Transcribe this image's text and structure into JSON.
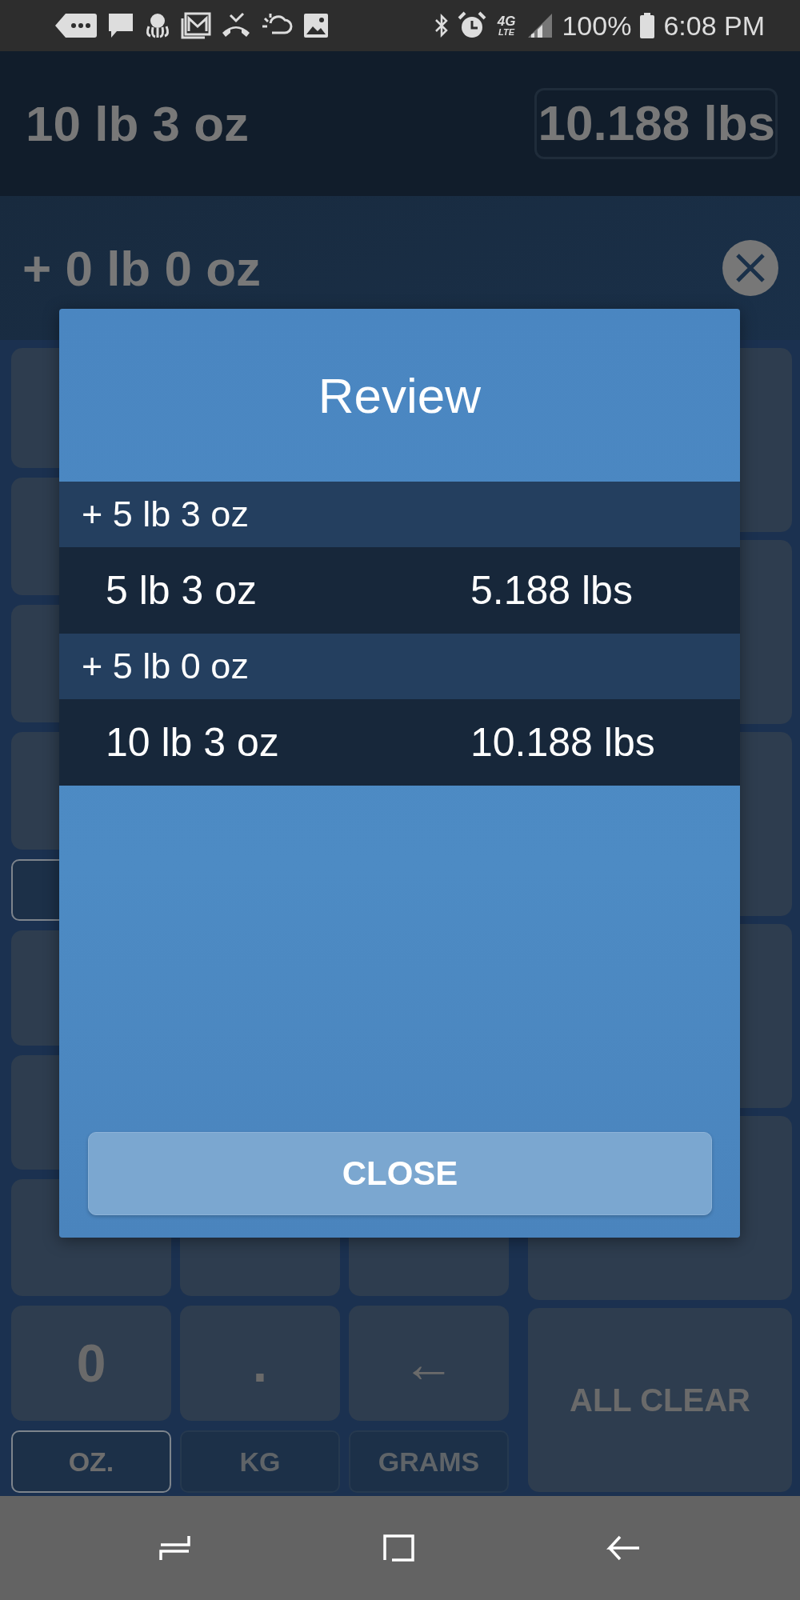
{
  "status_bar": {
    "network_top": "4G",
    "network_bottom": "LTE",
    "battery": "100%",
    "time": "6:08 PM"
  },
  "display": {
    "total": "10 lb 3 oz",
    "total_decimal": "10.188 lbs",
    "entry": "+ 0 lb 0 oz"
  },
  "keypad": {
    "upper_unit_toggle": {
      "selected": true
    },
    "keys": [
      {
        "label": "0"
      },
      {
        "label": "."
      },
      {
        "label": "←"
      }
    ],
    "units": [
      {
        "label": "OZ.",
        "selected": true
      },
      {
        "label": "KG",
        "selected": false
      },
      {
        "label": "GRAMS",
        "selected": false
      }
    ],
    "all_clear": "ALL CLEAR"
  },
  "dialog": {
    "title": "Review",
    "entries": [
      {
        "operation": "+ 5 lb 3 oz",
        "result": "5 lb 3 oz",
        "result_decimal": "5.188 lbs"
      },
      {
        "operation": "+ 5 lb 0 oz",
        "result": "10 lb 3 oz",
        "result_decimal": "10.188 lbs"
      }
    ],
    "close_button": "CLOSE"
  }
}
